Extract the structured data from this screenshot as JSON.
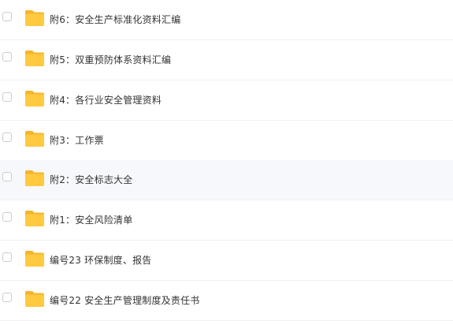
{
  "file_list": {
    "items": [
      {
        "name": "附6：安全生产标准化资料汇编",
        "type": "folder",
        "icon": "folder-icon",
        "checked": false
      },
      {
        "name": "附5：双重预防体系资料汇编",
        "type": "folder",
        "icon": "folder-icon",
        "checked": false
      },
      {
        "name": "附4：各行业安全管理资料",
        "type": "folder",
        "icon": "folder-icon",
        "checked": false
      },
      {
        "name": "附3：工作票",
        "type": "folder",
        "icon": "folder-icon",
        "checked": false
      },
      {
        "name": "附2：安全标志大全",
        "type": "folder",
        "icon": "folder-icon",
        "checked": false
      },
      {
        "name": "附1：安全风险清单",
        "type": "folder",
        "icon": "folder-icon",
        "checked": false
      },
      {
        "name": "编号23 环保制度、报告",
        "type": "folder",
        "icon": "folder-icon",
        "checked": false
      },
      {
        "name": "编号22 安全生产管理制度及责任书",
        "type": "folder",
        "icon": "folder-icon",
        "checked": false
      }
    ]
  },
  "colors": {
    "folder_fill": "#ffc940",
    "folder_tab": "#f5b52a",
    "hover_row_bg": "#f6f8fc",
    "text": "#333333"
  }
}
